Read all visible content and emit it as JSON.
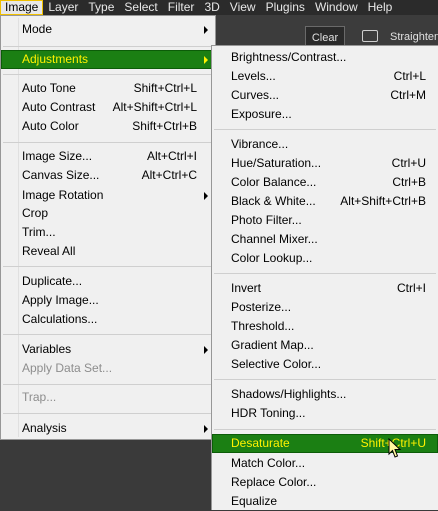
{
  "menubar": {
    "items": [
      "Image",
      "Layer",
      "Type",
      "Select",
      "Filter",
      "3D",
      "View",
      "Plugins",
      "Window",
      "Help"
    ],
    "active_index": 0
  },
  "toolbar": {
    "clear_label": "Clear",
    "straighten_label": "Straighten"
  },
  "image_menu": {
    "items": [
      {
        "label": "Mode",
        "submenu": true
      },
      {
        "label": "Adjustments",
        "submenu": true,
        "highlighted": true
      },
      {
        "label": "Auto Tone",
        "shortcut": "Shift+Ctrl+L"
      },
      {
        "label": "Auto Contrast",
        "shortcut": "Alt+Shift+Ctrl+L"
      },
      {
        "label": "Auto Color",
        "shortcut": "Shift+Ctrl+B"
      },
      {
        "label": "Image Size...",
        "shortcut": "Alt+Ctrl+I"
      },
      {
        "label": "Canvas Size...",
        "shortcut": "Alt+Ctrl+C"
      },
      {
        "label": "Image Rotation",
        "submenu": true
      },
      {
        "label": "Crop"
      },
      {
        "label": "Trim..."
      },
      {
        "label": "Reveal All"
      },
      {
        "label": "Duplicate..."
      },
      {
        "label": "Apply Image..."
      },
      {
        "label": "Calculations..."
      },
      {
        "label": "Variables",
        "submenu": true
      },
      {
        "label": "Apply Data Set...",
        "disabled": true
      },
      {
        "label": "Trap...",
        "disabled": true
      },
      {
        "label": "Analysis",
        "submenu": true
      }
    ]
  },
  "adjustments_menu": {
    "items": [
      {
        "label": "Brightness/Contrast..."
      },
      {
        "label": "Levels...",
        "shortcut": "Ctrl+L"
      },
      {
        "label": "Curves...",
        "shortcut": "Ctrl+M"
      },
      {
        "label": "Exposure..."
      },
      {
        "label": "Vibrance..."
      },
      {
        "label": "Hue/Saturation...",
        "shortcut": "Ctrl+U"
      },
      {
        "label": "Color Balance...",
        "shortcut": "Ctrl+B"
      },
      {
        "label": "Black & White...",
        "shortcut": "Alt+Shift+Ctrl+B"
      },
      {
        "label": "Photo Filter..."
      },
      {
        "label": "Channel Mixer..."
      },
      {
        "label": "Color Lookup..."
      },
      {
        "label": "Invert",
        "shortcut": "Ctrl+I"
      },
      {
        "label": "Posterize..."
      },
      {
        "label": "Threshold..."
      },
      {
        "label": "Gradient Map..."
      },
      {
        "label": "Selective Color..."
      },
      {
        "label": "Shadows/Highlights..."
      },
      {
        "label": "HDR Toning..."
      },
      {
        "label": "Desaturate",
        "shortcut": "Shift+Ctrl+U",
        "highlighted": true
      },
      {
        "label": "Match Color..."
      },
      {
        "label": "Replace Color..."
      },
      {
        "label": "Equalize"
      }
    ]
  },
  "colors": {
    "highlight_bg": "#1b7f13",
    "highlight_text": "#fff200",
    "menu_bg": "#f0f0f0",
    "menubar_bg": "#2b2b2b"
  }
}
